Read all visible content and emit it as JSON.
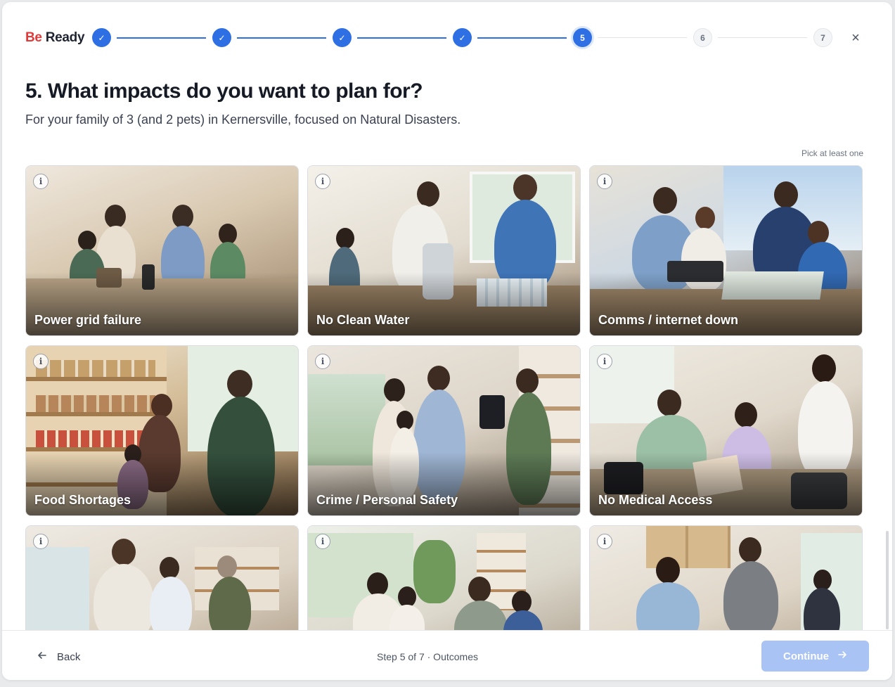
{
  "brand": {
    "part1": "Be",
    "part2": "Ready"
  },
  "stepper": {
    "steps": [
      {
        "label": "1",
        "state": "done"
      },
      {
        "label": "2",
        "state": "done"
      },
      {
        "label": "3",
        "state": "done"
      },
      {
        "label": "4",
        "state": "done"
      },
      {
        "label": "5",
        "state": "current"
      },
      {
        "label": "6",
        "state": "todo"
      },
      {
        "label": "7",
        "state": "todo"
      }
    ],
    "check_glyph": "✓",
    "close_glyph": "×"
  },
  "question": {
    "title": "5. What impacts do you want to plan for?",
    "subtitle": "For your family of 3 (and 2 pets) in Kernersville, focused on Natural Disasters.",
    "hint": "Pick at least one"
  },
  "cards": [
    {
      "label": "Power grid failure",
      "icon": "info-icon",
      "tone": [
        "#d9cdbb",
        "#8a7460"
      ]
    },
    {
      "label": "No Clean Water",
      "icon": "info-icon",
      "tone": [
        "#e6e2da",
        "#9a8a74"
      ]
    },
    {
      "label": "Comms / internet down",
      "icon": "info-icon",
      "tone": [
        "#c9d4dc",
        "#7b6a5c"
      ]
    },
    {
      "label": "Food Shortages",
      "icon": "info-icon",
      "tone": [
        "#d7c3a4",
        "#6d5842"
      ]
    },
    {
      "label": "Crime / Personal Safety",
      "icon": "info-icon",
      "tone": [
        "#e2ddd5",
        "#8c7d6c"
      ]
    },
    {
      "label": "No Medical Access",
      "icon": "info-icon",
      "tone": [
        "#e4ddd2",
        "#8f8070"
      ]
    },
    {
      "label": "",
      "icon": "info-icon",
      "tone": [
        "#e8e4dd",
        "#a0907e"
      ]
    },
    {
      "label": "",
      "icon": "info-icon",
      "tone": [
        "#e5e8e2",
        "#8c9a80"
      ]
    },
    {
      "label": "",
      "icon": "info-icon",
      "tone": [
        "#e9e4dc",
        "#9c8a74"
      ]
    }
  ],
  "footer": {
    "back_label": "Back",
    "back_icon": "arrow-left-icon",
    "step_text": "Step 5 of 7 · Outcomes",
    "continue_label": "Continue",
    "continue_icon": "arrow-right-icon"
  },
  "colors": {
    "accent": "#2f6fe4",
    "brand_red": "#e03a3a",
    "continue_disabled": "#a9c3f4"
  }
}
